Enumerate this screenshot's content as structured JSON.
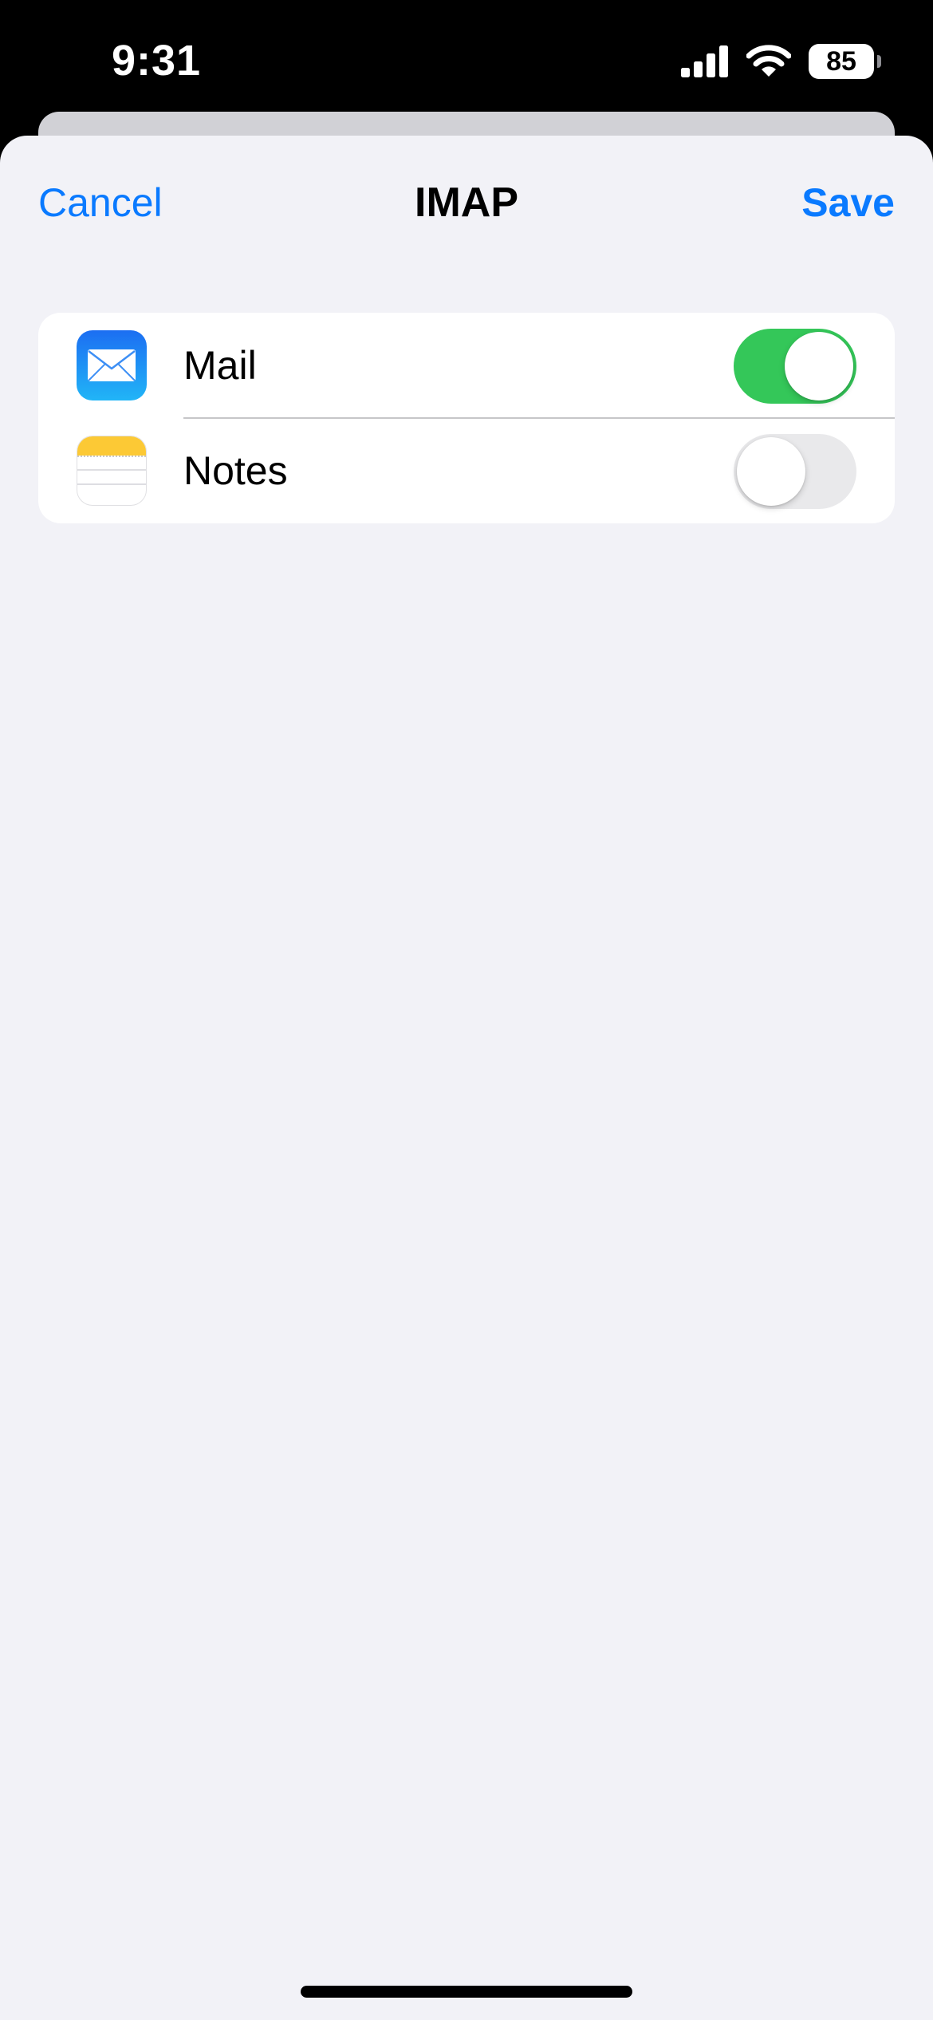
{
  "status_bar": {
    "time": "9:31",
    "battery_level": "85",
    "icons": [
      "cellular-signal-icon",
      "wifi-icon",
      "battery-icon"
    ]
  },
  "nav": {
    "cancel_label": "Cancel",
    "title": "IMAP",
    "save_label": "Save"
  },
  "settings": {
    "rows": [
      {
        "label": "Mail",
        "icon": "mail-app-icon",
        "enabled": true
      },
      {
        "label": "Notes",
        "icon": "notes-app-icon",
        "enabled": false
      }
    ]
  },
  "colors": {
    "accent": "#0a7aff",
    "toggle_on": "#34c759",
    "toggle_off": "#e9e9eb",
    "sheet_background": "#f2f2f7"
  }
}
